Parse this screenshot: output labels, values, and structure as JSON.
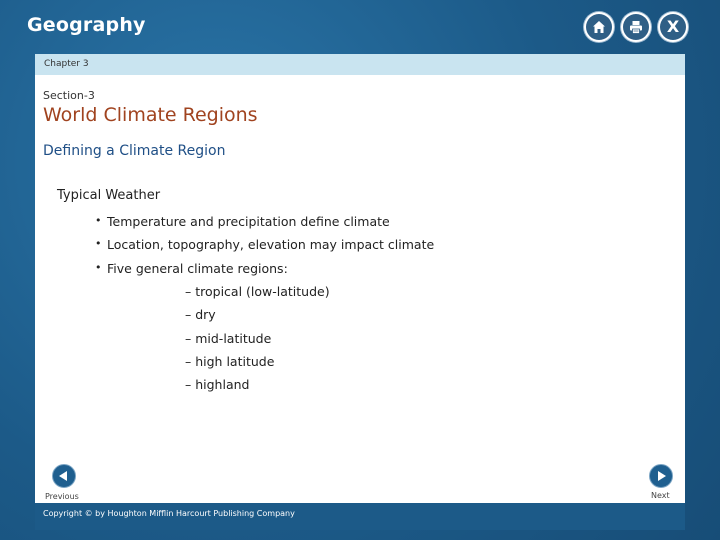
{
  "app": {
    "title": "Geography"
  },
  "toolbar": {
    "home_icon": "home-icon",
    "print_icon": "print-icon",
    "close_glyph": "X"
  },
  "header": {
    "chapter": "Chapter 3"
  },
  "slide": {
    "section": "Section-3",
    "title": "World Climate Regions",
    "subtitle": "Defining a Climate Region",
    "heading": "Typical Weather",
    "bullet_marker": "•",
    "bullets": [
      "Temperature and precipitation define climate",
      "Location, topography, elevation may impact climate",
      "Five general climate regions:"
    ],
    "regions": [
      "– tropical (low-latitude)",
      "– dry",
      "– mid-latitude",
      "– high latitude",
      "– highland"
    ]
  },
  "nav": {
    "previous": "Previous",
    "next": "Next"
  },
  "footer": {
    "copyright": "Copyright © by Houghton Mifflin Harcourt Publishing Company"
  },
  "colors": {
    "background": "#1d5f8f",
    "title_accent": "#a0431f",
    "subtitle": "#1f4f86",
    "chapter_bar": "#c9e4f0"
  }
}
